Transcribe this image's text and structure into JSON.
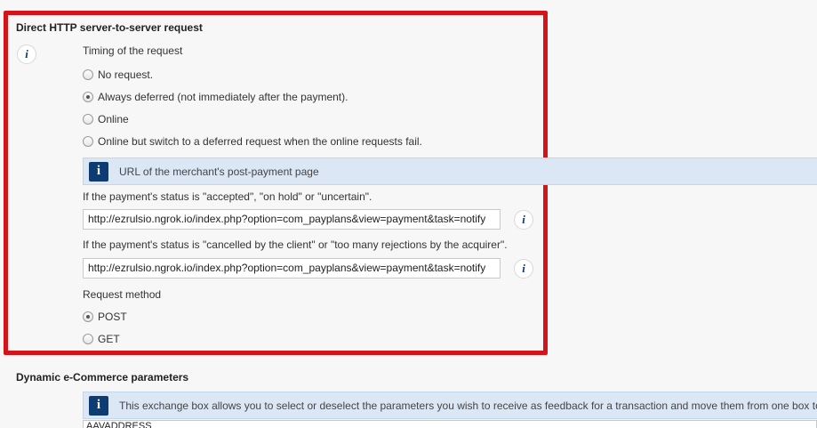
{
  "http_section": {
    "title": "Direct HTTP server-to-server request",
    "timing_label": "Timing of the request",
    "timing_options": [
      {
        "label": "No request.",
        "checked": false
      },
      {
        "label": "Always deferred (not immediately after the payment).",
        "checked": true
      },
      {
        "label": "Online",
        "checked": false
      },
      {
        "label": "Online but switch to a deferred request when the online requests fail.",
        "checked": false
      }
    ],
    "banner_text": "URL of the merchant's post-payment page",
    "accepted_label": "If the payment's status is \"accepted\", \"on hold\" or \"uncertain\".",
    "accepted_url": "http://ezrulsio.ngrok.io/index.php?option=com_payplans&view=payment&task=notify",
    "cancelled_label": "If the payment's status is \"cancelled by the client\" or \"too many rejections by the acquirer\".",
    "cancelled_url": "http://ezrulsio.ngrok.io/index.php?option=com_payplans&view=payment&task=notify",
    "method_label": "Request method",
    "method_options": [
      {
        "label": "POST",
        "checked": true
      },
      {
        "label": "GET",
        "checked": false
      }
    ]
  },
  "ecommerce_section": {
    "title": "Dynamic e-Commerce parameters",
    "banner_text": "This exchange box allows you to select or deselect the parameters you wish to receive as feedback for a transaction and move them from one box to anoth",
    "list_first_item": "AAVADDRESS"
  },
  "icons": {
    "info_glyph": "i",
    "banner_glyph": "i"
  },
  "colors": {
    "highlight_border": "#d5141a",
    "banner_bg": "#dbe7f5",
    "banner_icon_bg": "#0c3c72"
  }
}
